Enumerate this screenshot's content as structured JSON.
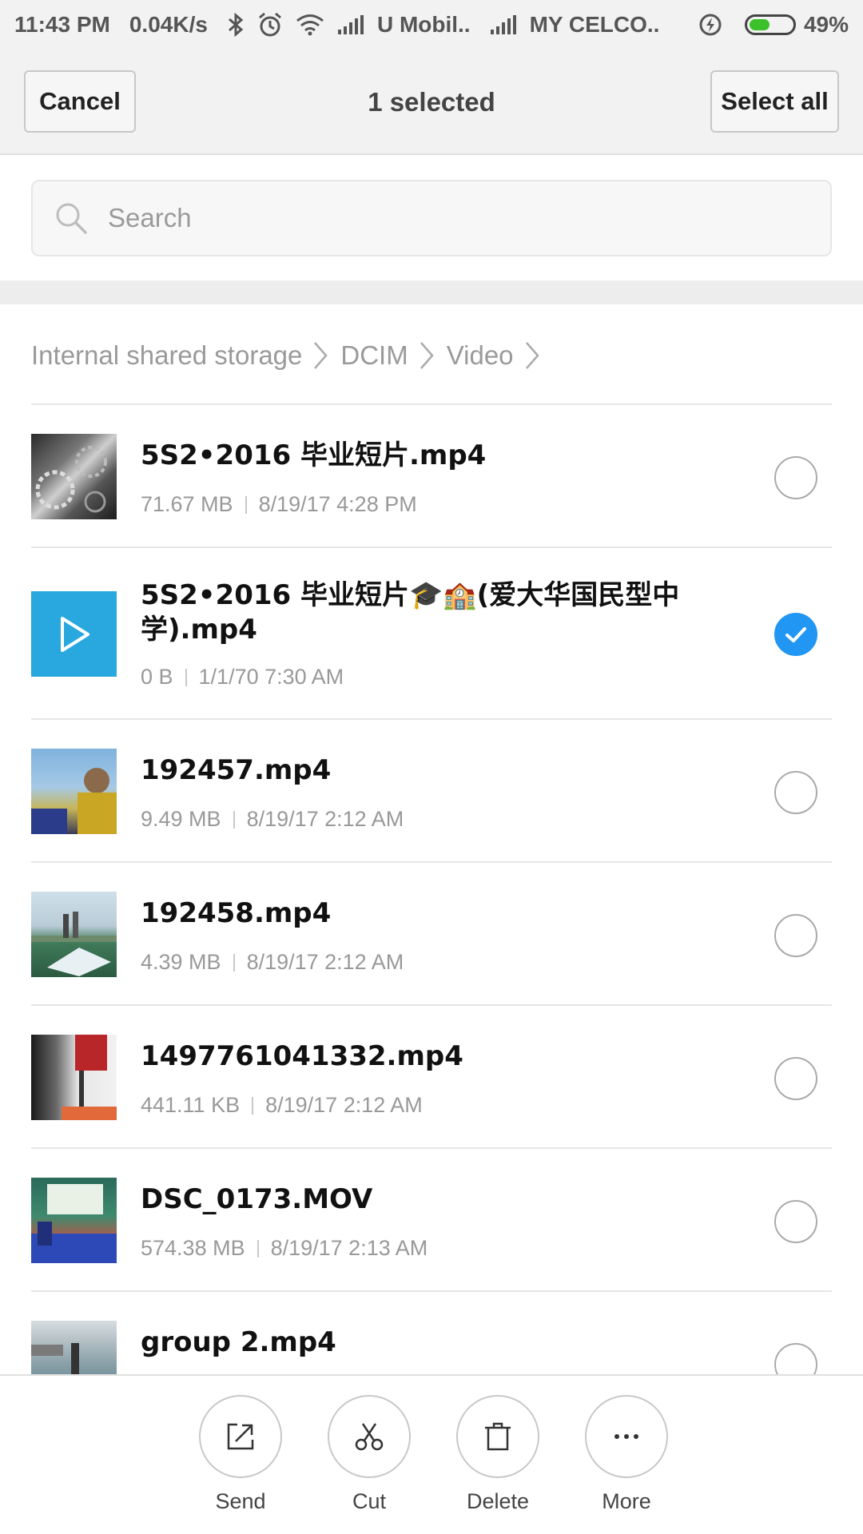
{
  "status_bar": {
    "time": "11:43 PM",
    "speed": "0.04K/s",
    "carrier1": "U Mobil..",
    "carrier2": "MY CELCO..",
    "battery": "49%",
    "battery_level": 0.49,
    "icons": [
      "bluetooth-icon",
      "alarm-icon",
      "wifi-icon",
      "signal-icon",
      "signal-icon",
      "charging-icon"
    ]
  },
  "header": {
    "cancel_label": "Cancel",
    "title": "1 selected",
    "select_all_label": "Select all"
  },
  "search": {
    "placeholder": "Search"
  },
  "breadcrumb": [
    "Internal shared storage",
    "DCIM",
    "Video"
  ],
  "files": [
    {
      "name": "5S2•2016 毕业短片.mp4",
      "size": "71.67 MB",
      "date": "8/19/17 4:28 PM",
      "selected": false
    },
    {
      "name": "5S2•2016 毕业短片🎓🏫(爱大华国民型中学).mp4",
      "size": "0 B",
      "date": "1/1/70 7:30 AM",
      "selected": true
    },
    {
      "name": "192457.mp4",
      "size": "9.49 MB",
      "date": "8/19/17 2:12 AM",
      "selected": false
    },
    {
      "name": "192458.mp4",
      "size": "4.39 MB",
      "date": "8/19/17 2:12 AM",
      "selected": false
    },
    {
      "name": "1497761041332.mp4",
      "size": "441.11 KB",
      "date": "8/19/17 2:12 AM",
      "selected": false
    },
    {
      "name": "DSC_0173.MOV",
      "size": "574.38 MB",
      "date": "8/19/17 2:13 AM",
      "selected": false
    },
    {
      "name": "group 2.mp4",
      "size": "",
      "date": "",
      "selected": false
    }
  ],
  "actions": [
    {
      "label": "Send",
      "icon": "send-icon"
    },
    {
      "label": "Cut",
      "icon": "scissors-icon"
    },
    {
      "label": "Delete",
      "icon": "trash-icon"
    },
    {
      "label": "More",
      "icon": "more-icon"
    }
  ],
  "colors": {
    "accent": "#2196f3",
    "battery": "#3cc12a"
  }
}
